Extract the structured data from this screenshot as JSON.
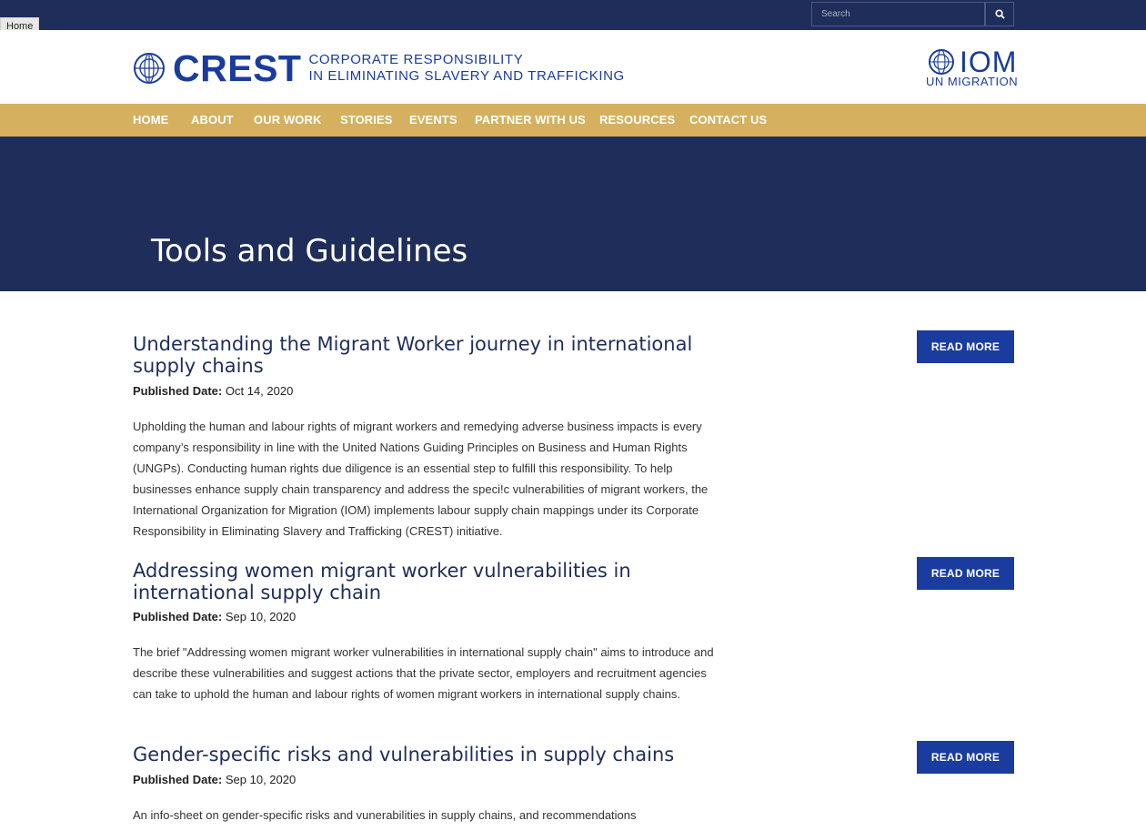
{
  "topbar": {
    "home_tooltip": "Home",
    "search_placeholder": "Search"
  },
  "header": {
    "crest_word": "CREST",
    "crest_tagline_line1": "CORPORATE RESPONSIBILITY",
    "crest_tagline_line2": "IN ELIMINATING SLAVERY AND TRAFFICKING",
    "iom_word": "IOM",
    "iom_sub": "UN MIGRATION"
  },
  "nav": {
    "items": [
      "HOME",
      "ABOUT",
      "OUR WORK",
      "STORIES",
      "EVENTS",
      "PARTNER WITH US",
      "RESOURCES",
      "CONTACT US"
    ]
  },
  "hero": {
    "title": "Tools and Guidelines"
  },
  "published_label": "Published Date:",
  "read_more_label": "READ MORE",
  "items": [
    {
      "title": "Understanding the Migrant Worker journey in international supply chains",
      "date": "Oct 14, 2020",
      "description": "Upholding the human and labour rights of migrant workers and remedying adverse business impacts is every company’s responsibility in line with the United Nations Guiding Principles on Business and Human Rights (UNGPs). Conducting human rights due diligence is an essential step to fulfill this responsibility. To help businesses enhance supply chain transparency and address the speci!c vulnerabilities of migrant workers, the International Organization for Migration (IOM) implements labour supply chain mappings under its Corporate Responsibility in Eliminating Slavery and Trafficking (CREST) initiative."
    },
    {
      "title": "Addressing women migrant worker vulnerabilities in international supply chain",
      "date": "Sep 10, 2020",
      "description": "The brief \"Addressing women migrant worker vulnerabilities in international supply chain\" aims to introduce and describe these vulnerabilities and suggest actions that the private sector, employers and recruitment agencies can take to uphold the human and labour rights of women migrant workers in international supply chains."
    },
    {
      "title": "Gender-specific risks and vulnerabilities in supply chains",
      "date": "Sep 10, 2020",
      "description": "An info-sheet on gender-specific risks and vunerabilities in supply chains, and recommendations"
    }
  ],
  "colors": {
    "navy": "#1f2d5a",
    "gold": "#d4b05f",
    "brand_blue": "#1a3c9e"
  }
}
